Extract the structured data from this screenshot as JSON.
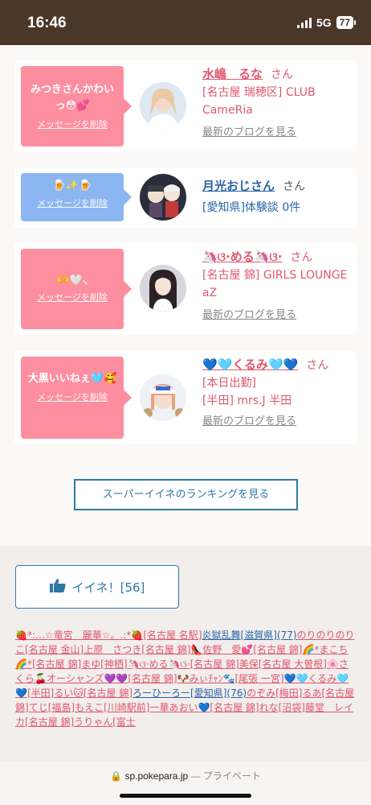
{
  "status": {
    "time": "16:46",
    "network": "5G",
    "battery": "77"
  },
  "cards": [
    {
      "message": "みつきさんかわいっ😳💕",
      "delete_label": "メッセージを削除",
      "name": "水嶋　るな",
      "san": "さん",
      "shop_lines": [
        "[名古屋 瑞穂区] CLUB CameRia"
      ],
      "blog_label": "最新のブログを見る"
    },
    {
      "message": "🍺✨🍺",
      "delete_label": "メッセージを削除",
      "name": "月光おじさん",
      "san": "さん",
      "shop_lines": [
        "[愛知県]体験談 0件"
      ],
      "blog_label": ""
    },
    {
      "message": "🫶🤍⸜",
      "delete_label": "メッセージを削除",
      "name": "🦄ଓ·める🦄ଓ·",
      "san": "さん",
      "shop_lines": [
        "[名古屋 錦] GIRLS LOUNGE aZ"
      ],
      "blog_label": "最新のブログを見る"
    },
    {
      "message": "大黒いいねぇ🩵🥰",
      "delete_label": "メッセージを削除",
      "name": "💙🩵くるみ🩵💙",
      "san": "さん",
      "shop_lines": [
        "[本日出勤]",
        "[半田] mrs.J 半田"
      ],
      "blog_label": "最新のブログを見る"
    }
  ],
  "ranking_button": "スーパーイイネのランキングを見る",
  "like_button": {
    "label": "イイネ！[56]"
  },
  "links": [
    {
      "t": "🍓*:…☆竜宮　麗華☆。.:*🍓",
      "c": "lk"
    },
    {
      "t": "[名古屋 名駅]",
      "c": "lk"
    },
    {
      "t": "炎獄乱舞",
      "c": "lb"
    },
    {
      "t": "[滋賀県]",
      "c": "lb"
    },
    {
      "t": "(77)",
      "c": "lb"
    },
    {
      "t": "のりのりのりこ",
      "c": "lk"
    },
    {
      "t": "[名古屋 金山]",
      "c": "lk"
    },
    {
      "t": "上原　さつき",
      "c": "lk"
    },
    {
      "t": "[名古屋 錦]",
      "c": "lk"
    },
    {
      "t": "👠佐野　愛💕",
      "c": "lk"
    },
    {
      "t": "[名古屋 錦]",
      "c": "lk"
    },
    {
      "t": "🌈*まこち🌈*",
      "c": "lk"
    },
    {
      "t": "[名古屋 錦]",
      "c": "lk"
    },
    {
      "t": "まゆ",
      "c": "lk"
    },
    {
      "t": "[神栖]",
      "c": "lk"
    },
    {
      "t": "🦄ଓ·める🦄ଓ·",
      "c": "lk"
    },
    {
      "t": "[名古屋 錦]",
      "c": "lk"
    },
    {
      "t": "美保",
      "c": "lk"
    },
    {
      "t": "[名古屋 大曽根]",
      "c": "lk"
    },
    {
      "t": "🌸さくら🍒",
      "c": "lk"
    },
    {
      "t": "オーシャンズ💜💜",
      "c": "lk"
    },
    {
      "t": "[名古屋 錦]",
      "c": "lk"
    },
    {
      "t": "🐶みぃﾁｬﾝ🐾",
      "c": "lk"
    },
    {
      "t": "[尾張 一宮]",
      "c": "lk"
    },
    {
      "t": "💙🩵くるみ🩵💙",
      "c": "lk"
    },
    {
      "t": "[半田]",
      "c": "lk"
    },
    {
      "t": "るい🐱",
      "c": "lk"
    },
    {
      "t": "[名古屋 錦]",
      "c": "lk"
    },
    {
      "t": "ろーひーろー",
      "c": "lb"
    },
    {
      "t": "[愛知県]",
      "c": "lb"
    },
    {
      "t": "(76)",
      "c": "lb"
    },
    {
      "t": "のぞみ",
      "c": "lk"
    },
    {
      "t": "[梅田]",
      "c": "lk"
    },
    {
      "t": "るあ",
      "c": "lk"
    },
    {
      "t": "[名古屋 錦]",
      "c": "lk"
    },
    {
      "t": "てじ",
      "c": "lk"
    },
    {
      "t": "[福島]",
      "c": "lk"
    },
    {
      "t": "もえこ",
      "c": "lk"
    },
    {
      "t": "[川崎駅前]",
      "c": "lk"
    },
    {
      "t": "一華あおい💙",
      "c": "lk"
    },
    {
      "t": "[名古屋 錦]",
      "c": "lk"
    },
    {
      "t": "れな",
      "c": "lk"
    },
    {
      "t": "[沼袋]",
      "c": "lk"
    },
    {
      "t": "藤堂　レイカ",
      "c": "lk"
    },
    {
      "t": "[名古屋 錦]",
      "c": "lk"
    },
    {
      "t": "うりゃん",
      "c": "lk"
    },
    {
      "t": "[富士",
      "c": "lk"
    }
  ],
  "url_bar": {
    "host": "sp.pokepara.jp",
    "sep": " — ",
    "mode": "プライベート"
  },
  "colors": {
    "header_brown": "#4a3728",
    "pink": "#fd8ea0",
    "blue": "#8cb6f2",
    "link_pink": "#e0576e",
    "link_blue": "#2b64a8"
  }
}
